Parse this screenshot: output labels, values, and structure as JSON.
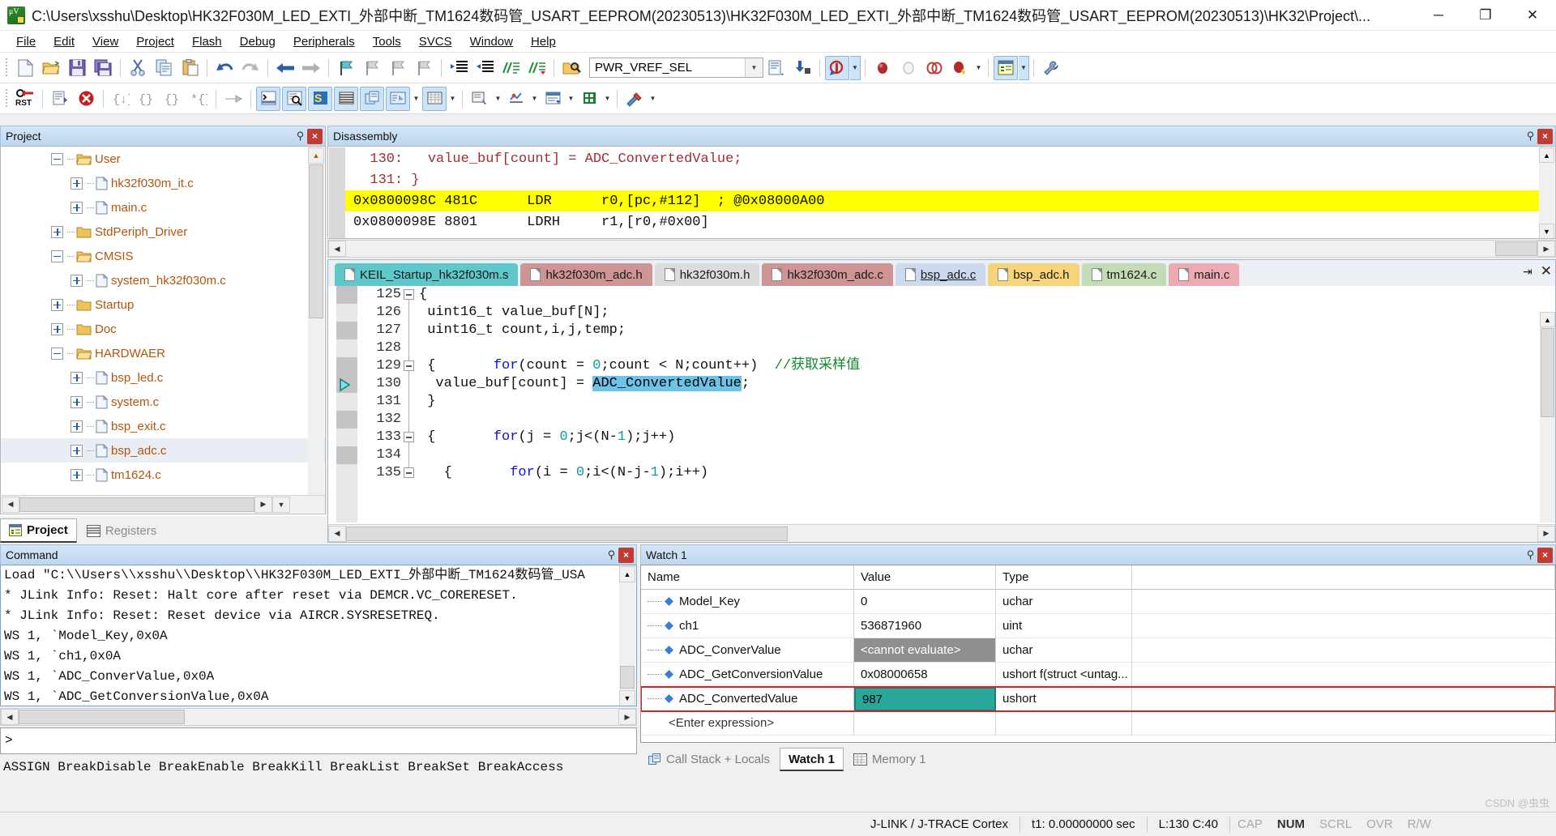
{
  "window": {
    "title": "C:\\Users\\xsshu\\Desktop\\HK32F030M_LED_EXTI_外部中断_TM1624数码管_USART_EEPROM(20230513)\\HK32F030M_LED_EXTI_外部中断_TM1624数码管_USART_EEPROM(20230513)\\HK32\\Project\\...",
    "minimize": "─",
    "maximize": "❐",
    "close": "✕"
  },
  "menu": {
    "items": [
      {
        "label": "File",
        "accel": "F"
      },
      {
        "label": "Edit",
        "accel": "E"
      },
      {
        "label": "View",
        "accel": "V"
      },
      {
        "label": "Project",
        "accel": "P"
      },
      {
        "label": "Flash",
        "accel": "a"
      },
      {
        "label": "Debug",
        "accel": "D"
      },
      {
        "label": "Peripherals",
        "accel": "r"
      },
      {
        "label": "Tools",
        "accel": "T"
      },
      {
        "label": "SVCS",
        "accel": "S"
      },
      {
        "label": "Window",
        "accel": "W"
      },
      {
        "label": "Help",
        "accel": "H"
      }
    ]
  },
  "toolbar_main": {
    "target_combo_value": "PWR_VREF_SEL",
    "icons": [
      "new-file-icon",
      "open-file-icon",
      "save-icon",
      "save-all-icon",
      "cut-icon",
      "copy-icon",
      "paste-icon",
      "undo-icon",
      "redo-icon",
      "navigate-back-icon",
      "navigate-forward-icon",
      "bookmark-toggle-icon",
      "bookmark-prev-icon",
      "bookmark-next-icon",
      "bookmark-clear-icon",
      "indent-right-icon",
      "indent-left-icon",
      "comment-icon",
      "uncomment-icon",
      "find-in-files-icon",
      "target-options-icon",
      "batch-build-icon",
      "configure-flash-icon",
      "debug-session-icon",
      "insert-breakpoint-icon",
      "disable-breakpoint-icon",
      "kill-breakpoints-icon",
      "disable-all-breakpoints-icon",
      "manage-project-icon",
      "configure-toolbar-icon"
    ]
  },
  "toolbar_debug": {
    "icons": [
      "reset-cpu-icon",
      "run-icon",
      "stop-icon",
      "step-icon",
      "step-over-icon",
      "step-out-icon",
      "run-to-cursor-icon",
      "show-next-statement-icon",
      "command-window-icon",
      "disassembly-window-icon",
      "symbols-window-icon",
      "registers-window-icon",
      "call-stack-icon",
      "watch-window-icon",
      "memory-window-icon",
      "serial-window-icon",
      "analysis-window-icon",
      "trace-window-icon",
      "system-viewer-icon",
      "toolbox-icon"
    ]
  },
  "project_panel": {
    "title": "Project",
    "tree": [
      {
        "label": "User",
        "type": "folder-open",
        "indent": 1,
        "expander": "minus"
      },
      {
        "label": "hk32f030m_it.c",
        "type": "file",
        "indent": 2,
        "expander": "plus"
      },
      {
        "label": "main.c",
        "type": "file",
        "indent": 2,
        "expander": "plus"
      },
      {
        "label": "StdPeriph_Driver",
        "type": "folder",
        "indent": 1,
        "expander": "plus"
      },
      {
        "label": "CMSIS",
        "type": "folder-open",
        "indent": 1,
        "expander": "minus"
      },
      {
        "label": "system_hk32f030m.c",
        "type": "file",
        "indent": 2,
        "expander": "plus"
      },
      {
        "label": "Startup",
        "type": "folder",
        "indent": 1,
        "expander": "plus"
      },
      {
        "label": "Doc",
        "type": "folder",
        "indent": 1,
        "expander": "plus"
      },
      {
        "label": "HARDWAER",
        "type": "folder-open",
        "indent": 1,
        "expander": "minus"
      },
      {
        "label": "bsp_led.c",
        "type": "file",
        "indent": 2,
        "expander": "plus"
      },
      {
        "label": "system.c",
        "type": "file",
        "indent": 2,
        "expander": "plus"
      },
      {
        "label": "bsp_exit.c",
        "type": "file",
        "indent": 2,
        "expander": "plus"
      },
      {
        "label": "bsp_adc.c",
        "type": "file",
        "indent": 2,
        "expander": "plus",
        "selected": true
      },
      {
        "label": "tm1624.c",
        "type": "file",
        "indent": 2,
        "expander": "plus"
      }
    ],
    "tabs": [
      {
        "label": "Project",
        "icon": "project-icon",
        "active": true
      },
      {
        "label": "Registers",
        "icon": "registers-icon",
        "active": false
      }
    ]
  },
  "disassembly": {
    "title": "Disassembly",
    "lines": [
      {
        "text": "  130:   value_buf[count] = ADC_ConvertedValue; ",
        "kind": "source"
      },
      {
        "text": "  131: }  ",
        "kind": "source"
      },
      {
        "text": "0x0800098C 481C      LDR      r0,[pc,#112]  ; @0x08000A00",
        "kind": "asm",
        "highlight": true
      },
      {
        "text": "0x0800098E 8801      LDRH     r1,[r0,#0x00]",
        "kind": "asm",
        "highlight": false
      }
    ]
  },
  "editor": {
    "tabs": [
      {
        "label": "KEIL_Startup_hk32f030m.s",
        "color": "#5fc8cb",
        "active": false
      },
      {
        "label": "hk32f030m_adc.h",
        "color": "#cf9595",
        "active": false
      },
      {
        "label": "hk32f030m.h",
        "color": "#d8d8d8",
        "active": false
      },
      {
        "label": "hk32f030m_adc.c",
        "color": "#cf9595",
        "active": false
      },
      {
        "label": "bsp_adc.c",
        "color": "#ccd9ef",
        "active": true
      },
      {
        "label": "bsp_adc.h",
        "color": "#f7d37a",
        "active": false
      },
      {
        "label": "tm1624.c",
        "color": "#c3dcb5",
        "active": false
      },
      {
        "label": "main.c",
        "color": "#eeaab2",
        "active": false
      }
    ],
    "tab_menu_icon": "tab-list-icon",
    "tab_close_icon": "tab-close-icon",
    "lines": [
      {
        "n": "125",
        "code": "{",
        "fold": true,
        "bp": false,
        "pc": false
      },
      {
        "n": "126",
        "code": " uint16_t value_buf[N];",
        "fold": false,
        "bp": true,
        "pc": false
      },
      {
        "n": "127",
        "code": " uint16_t count,i,j,temp;",
        "fold": false,
        "bp": false,
        "pc": false
      },
      {
        "n": "128",
        "code": " for(count = 0;count < N;count++)  //获取采样值",
        "fold": false,
        "bp": true,
        "pc": false
      },
      {
        "n": "129",
        "code": " {",
        "fold": true,
        "bp": false,
        "pc": false
      },
      {
        "n": "130",
        "code": "  value_buf[count] = ADC_ConvertedValue;",
        "fold": false,
        "bp": true,
        "pc": true
      },
      {
        "n": "131",
        "code": " }",
        "fold": false,
        "bp": false,
        "pc": false
      },
      {
        "n": "132",
        "code": " for(j = 0;j<(N-1);j++)",
        "fold": false,
        "bp": true,
        "pc": false
      },
      {
        "n": "133",
        "code": " {",
        "fold": true,
        "bp": false,
        "pc": false
      },
      {
        "n": "134",
        "code": "   for(i = 0;i<(N-j-1);i++)",
        "fold": false,
        "bp": true,
        "pc": false
      },
      {
        "n": "135",
        "code": "   {",
        "fold": true,
        "bp": false,
        "pc": false
      }
    ],
    "selected_token": "ADC_ConvertedValue"
  },
  "command_window": {
    "title": "Command",
    "lines": [
      "Load \"C:\\\\Users\\\\xsshu\\\\Desktop\\\\HK32F030M_LED_EXTI_外部中断_TM1624数码管_USA",
      "* JLink Info: Reset: Halt core after reset via DEMCR.VC_CORERESET.",
      "* JLink Info: Reset: Reset device via AIRCR.SYSRESETREQ.",
      "WS 1, `Model_Key,0x0A",
      "WS 1, `ch1,0x0A",
      "WS 1, `ADC_ConverValue,0x0A",
      "WS 1, `ADC_GetConversionValue,0x0A"
    ],
    "prompt": ">",
    "hint": "ASSIGN BreakDisable BreakEnable BreakKill BreakList BreakSet BreakAccess"
  },
  "watch_window": {
    "title": "Watch 1",
    "columns": [
      "Name",
      "Value",
      "Type"
    ],
    "rows": [
      {
        "name": "Model_Key",
        "value": "0",
        "type": "uchar",
        "state": "normal"
      },
      {
        "name": "ch1",
        "value": "536871960",
        "type": "uint",
        "state": "normal"
      },
      {
        "name": "ADC_ConverValue",
        "value": "<cannot evaluate>",
        "type": "uchar",
        "state": "cannot-evaluate"
      },
      {
        "name": "ADC_GetConversionValue",
        "value": "0x08000658",
        "type": "ushort f(struct <untag...",
        "state": "normal"
      },
      {
        "name": "ADC_ConvertedValue",
        "value": "987",
        "type": "ushort",
        "state": "editing"
      }
    ],
    "new_row_placeholder": "<Enter expression>",
    "tabs": [
      {
        "label": "Call Stack + Locals",
        "icon": "call-stack-icon",
        "active": false
      },
      {
        "label": "Watch 1",
        "icon": "watch-icon",
        "active": true
      },
      {
        "label": "Memory 1",
        "icon": "memory-icon",
        "active": false
      }
    ]
  },
  "statusbar": {
    "debugger": "J-LINK / J-TRACE Cortex",
    "time": "t1: 0.00000000 sec",
    "position": "L:130 C:40",
    "indicators": [
      {
        "label": "CAP",
        "on": false
      },
      {
        "label": "NUM",
        "on": true
      },
      {
        "label": "SCRL",
        "on": false
      },
      {
        "label": "OVR",
        "on": false
      },
      {
        "label": "R/W",
        "on": false
      }
    ]
  },
  "colors": {
    "titlebar_bg": "#ffffff",
    "panel_header": "#bcd7f0",
    "pc_highlight": "#ffff00",
    "selection": "#6fc3e8",
    "watch_edit": "#2aa79b",
    "watch_cannot": "#8f8f8f",
    "tree_text": "#b5540a",
    "keyword": "#1414c8",
    "comment": "#0f8a2c",
    "number": "#0e9b9b"
  }
}
